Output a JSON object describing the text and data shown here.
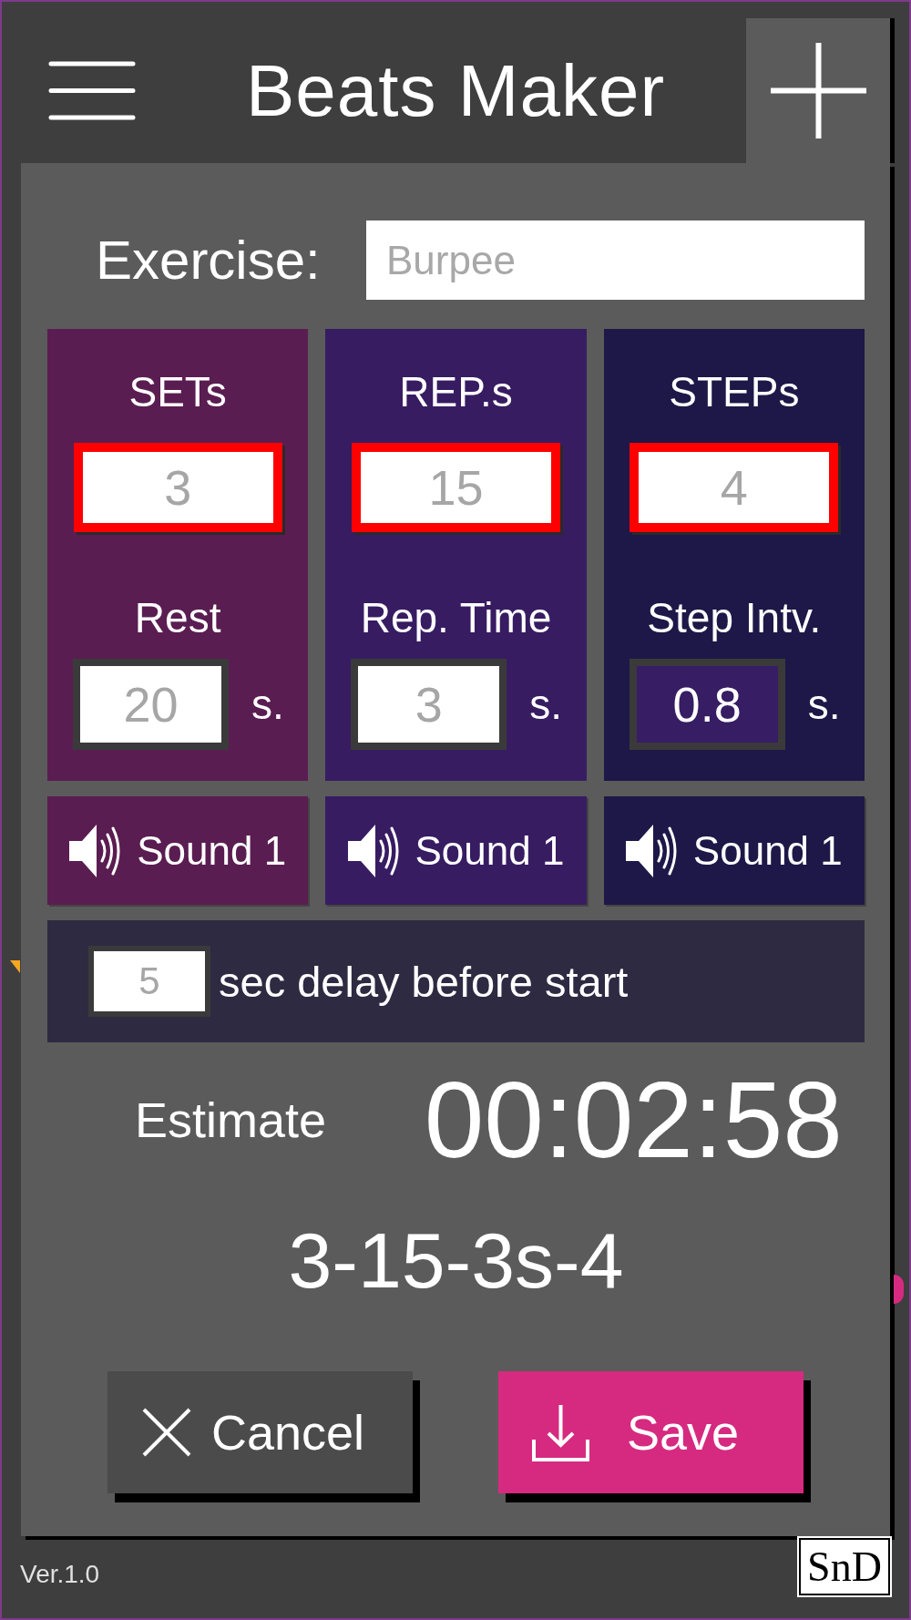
{
  "header": {
    "title": "Beats Maker"
  },
  "dialog": {
    "exercise": {
      "label": "Exercise:",
      "placeholder": "Burpee"
    },
    "columns": [
      {
        "title": "SETs",
        "color": "#5a1d51",
        "count": {
          "placeholder": "3",
          "highlighted": true,
          "focused": false
        },
        "interval_label": "Rest",
        "interval": {
          "placeholder": "20",
          "highlighted": false,
          "focused": false
        },
        "unit": "s.",
        "sound": "Sound 1"
      },
      {
        "title": "REP.s",
        "color": "#371c62",
        "count": {
          "placeholder": "15",
          "highlighted": true,
          "focused": false
        },
        "interval_label": "Rep. Time",
        "interval": {
          "placeholder": "3",
          "highlighted": false,
          "focused": false
        },
        "unit": "s.",
        "sound": "Sound 1"
      },
      {
        "title": "STEPs",
        "color": "#1d1847",
        "count": {
          "placeholder": "4",
          "highlighted": true,
          "focused": false
        },
        "interval_label": "Step Intv.",
        "interval": {
          "value": "0.8",
          "highlighted": false,
          "focused": true
        },
        "unit": "s.",
        "sound": "Sound 1"
      }
    ],
    "delay": {
      "placeholder": "5",
      "label": "sec delay before start"
    },
    "estimate": {
      "label": "Estimate",
      "value": "00:02:58"
    },
    "summary": "3-15-3s-4",
    "buttons": [
      {
        "kind": "cancel",
        "label": "Cancel"
      },
      {
        "kind": "save",
        "label": "Save"
      }
    ]
  },
  "footer": {
    "version": "Ver.1.0",
    "logo": "SnD"
  }
}
